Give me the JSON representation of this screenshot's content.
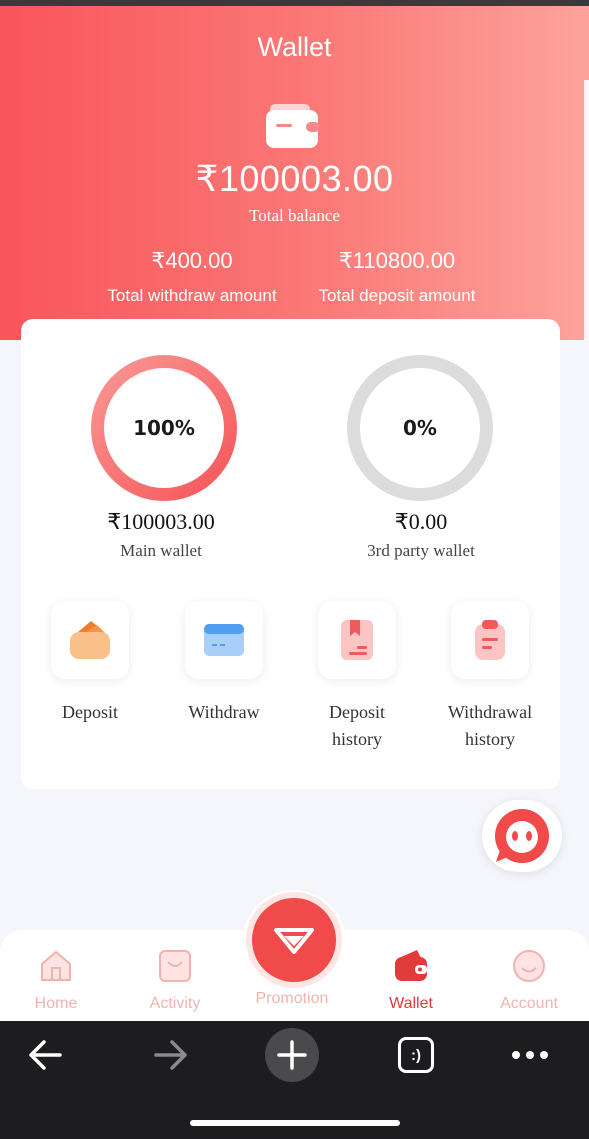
{
  "header": {
    "title": "Wallet",
    "total_balance": "₹100003.00",
    "total_balance_label": "Total balance",
    "withdraw_amount": "₹400.00",
    "withdraw_label": "Total withdraw amount",
    "deposit_amount": "₹110800.00",
    "deposit_label": "Total deposit amount"
  },
  "wallets": {
    "main": {
      "percent": "100%",
      "amount": "₹100003.00",
      "label": "Main wallet"
    },
    "third_party": {
      "percent": "0%",
      "amount": "₹0.00",
      "label": "3rd party wallet"
    }
  },
  "actions": [
    {
      "label": "Deposit",
      "icon": "deposit-icon"
    },
    {
      "label": "Withdraw",
      "icon": "withdraw-card-icon"
    },
    {
      "label": "Deposit history",
      "icon": "deposit-history-icon"
    },
    {
      "label": "Withdrawal history",
      "icon": "withdrawal-history-icon"
    }
  ],
  "nav": {
    "items": [
      {
        "label": "Home",
        "icon": "home-icon",
        "active": false
      },
      {
        "label": "Activity",
        "icon": "activity-icon",
        "active": false
      },
      {
        "label": "Promotion",
        "icon": "diamond-icon",
        "active": false
      },
      {
        "label": "Wallet",
        "icon": "wallet-icon",
        "active": true
      },
      {
        "label": "Account",
        "icon": "account-icon",
        "active": false
      }
    ]
  },
  "colors": {
    "accent": "#f04a4a",
    "header_gradient_start": "#f9555a",
    "header_gradient_end": "#fda39b",
    "inactive_nav": "#f2b3b0"
  },
  "browser": {
    "buttons": [
      "back-arrow-icon",
      "forward-arrow-icon",
      "new-tab-plus-icon",
      "tabs-icon",
      "more-dots-icon"
    ],
    "tabs_glyph": ":)"
  }
}
